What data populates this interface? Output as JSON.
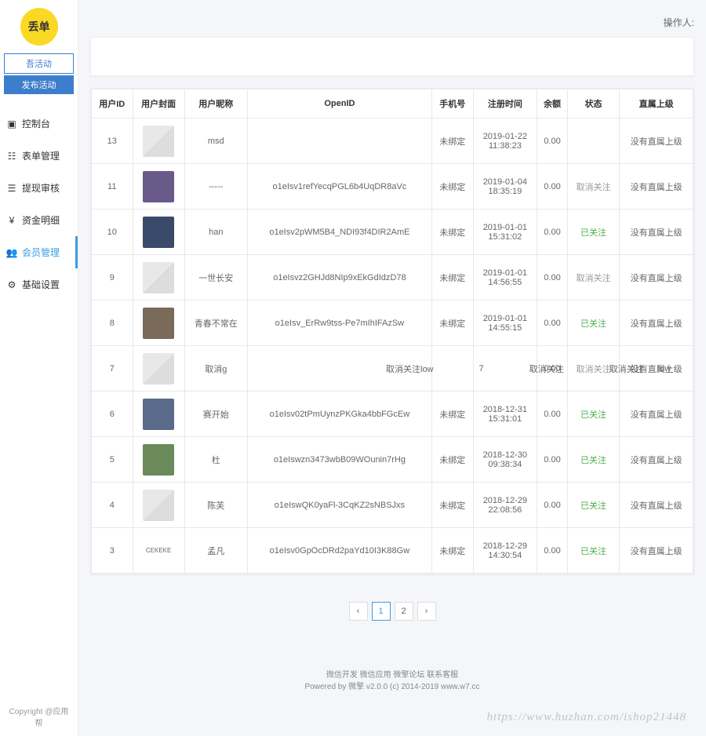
{
  "header": {
    "operator_label": "操作人:"
  },
  "logo": {
    "text": "丢单"
  },
  "nav_buttons": [
    {
      "label": "吾活动"
    },
    {
      "label": "发布活动"
    }
  ],
  "sidebar": {
    "items": [
      {
        "icon": "dashboard-icon",
        "label": "控制台"
      },
      {
        "icon": "form-icon",
        "label": "表单管理"
      },
      {
        "icon": "audit-icon",
        "label": "提现审核"
      },
      {
        "icon": "fund-icon",
        "label": "资金明细"
      },
      {
        "icon": "member-icon",
        "label": "会员管理",
        "active": true
      },
      {
        "icon": "settings-icon",
        "label": "基础设置"
      }
    ],
    "copyright": "Copyright @应用帮"
  },
  "table": {
    "headers": [
      "用户ID",
      "用户封面",
      "用户昵称",
      "OpenID",
      "手机号",
      "注册时间",
      "余额",
      "状态",
      "直属上级"
    ],
    "rows": [
      {
        "id": "13",
        "avatar": "placeholder",
        "nickname": "msd",
        "openid": "",
        "phone": "未绑定",
        "regtime": "2019-01-22\n11:38:23",
        "balance": "0.00",
        "status": "",
        "status_cls": "",
        "superior": "没有直属上级"
      },
      {
        "id": "11",
        "avatar": "img",
        "nickname": "-----",
        "openid": "o1eIsv1refYecqPGL6b4UqDR8aVc",
        "phone": "未绑定",
        "regtime": "2019-01-04\n18:35:19",
        "balance": "0.00",
        "status": "取消关注",
        "status_cls": "status-gray",
        "superior": "没有直属上级"
      },
      {
        "id": "10",
        "avatar": "img",
        "nickname": "han",
        "openid": "o1eIsv2pWM5B4_NDI93f4DIR2AmE",
        "phone": "未绑定",
        "regtime": "2019-01-01\n15:31:02",
        "balance": "0.00",
        "status": "已关注",
        "status_cls": "status-green",
        "superior": "没有直属上级"
      },
      {
        "id": "9",
        "avatar": "placeholder",
        "nickname": "一世长安",
        "openid": "o1eIsvz2GHJd8NIp9xEkGdIdzD78",
        "phone": "未绑定",
        "regtime": "2019-01-01\n14:56:55",
        "balance": "0.00",
        "status": "取消关注",
        "status_cls": "status-gray",
        "superior": "没有直属上级"
      },
      {
        "id": "8",
        "avatar": "img",
        "nickname": "青春不常在",
        "openid": "o1eIsv_ErRw9tss-Pe7mIhIFAzSw",
        "phone": "未绑定",
        "regtime": "2019-01-01\n14:55:15",
        "balance": "0.00",
        "status": "已关注",
        "status_cls": "status-green",
        "superior": "没有直属上级"
      },
      {
        "id": "7",
        "avatar": "placeholder",
        "nickname": "取消g",
        "openid": "",
        "phone": "",
        "regtime": "",
        "balance": "0.00",
        "status": "取消关注",
        "status_cls": "status-gray",
        "superior": "没有直属上级"
      },
      {
        "id": "6",
        "avatar": "img",
        "nickname": "赛开始",
        "openid": "o1eIsv02tPmUynzPKGka4bbFGcEw",
        "phone": "未绑定",
        "regtime": "2018-12-31\n15:31:01",
        "balance": "0.00",
        "status": "已关注",
        "status_cls": "status-green",
        "superior": "没有直属上级"
      },
      {
        "id": "5",
        "avatar": "img",
        "nickname": "杜",
        "openid": "o1eIswzn3473wbB09WOunin7rHg",
        "phone": "未绑定",
        "regtime": "2018-12-30\n09:38:34",
        "balance": "0.00",
        "status": "已关注",
        "status_cls": "status-green",
        "superior": "没有直属上级"
      },
      {
        "id": "4",
        "avatar": "placeholder",
        "nickname": "陈芙",
        "openid": "o1eIswQK0yaFl-3CqKZ2sNBSJxs",
        "phone": "未绑定",
        "regtime": "2018-12-29\n22:08:56",
        "balance": "0.00",
        "status": "已关注",
        "status_cls": "status-green",
        "superior": "没有直属上级"
      },
      {
        "id": "3",
        "avatar": "text",
        "avatar_text": "CEKEKE",
        "nickname": "孟凡",
        "openid": "o1eIsv0GpOcDRd2paYd10I3K88Gw",
        "phone": "未绑定",
        "regtime": "2018-12-29\n14:30:54",
        "balance": "0.00",
        "status": "已关注",
        "status_cls": "status-green",
        "superior": "没有直属上级"
      }
    ],
    "overlay_row7": {
      "f1": "取消关注low",
      "f2": "7",
      "f3": "取消关注",
      "f4": "取消关注",
      "f5": "low"
    }
  },
  "pagination": {
    "prev": "‹",
    "pages": [
      "1",
      "2"
    ],
    "next": "›",
    "active": 0
  },
  "footer": {
    "links": "微信开发 微信应用 微擎论坛 联系客服",
    "poweredby": "Powered by 微擎 v2.0.0 (c) 2014-2019 www.w7.cc"
  },
  "watermark": "https://www.huzhan.com/ishop21448"
}
